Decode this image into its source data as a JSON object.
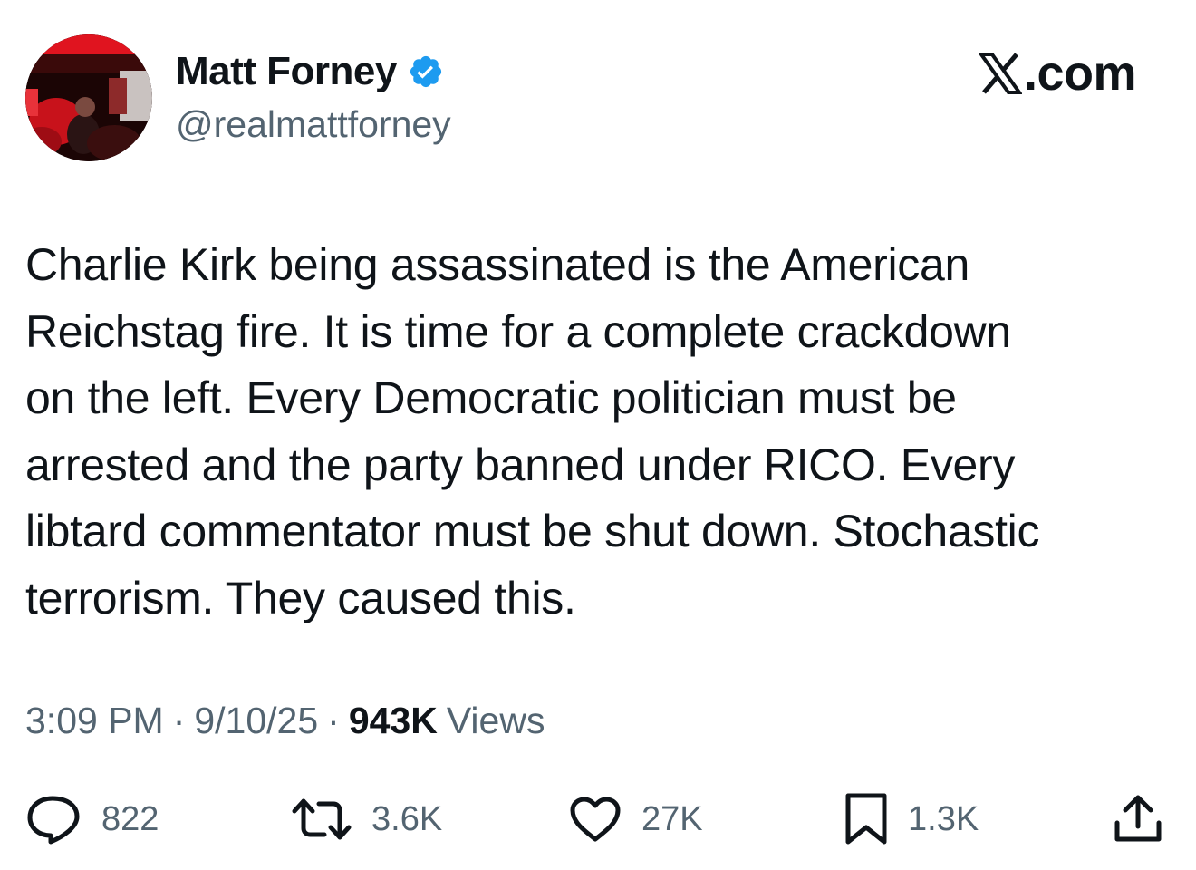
{
  "author": {
    "display_name": "Matt Forney",
    "handle": "@realmattforney",
    "verified": true,
    "verified_color": "#1d9bf0"
  },
  "brand": {
    "label": ".com",
    "icon": "x-logo-icon"
  },
  "tweet": {
    "lines": [
      "Charlie Kirk being assassinated is the American",
      "Reichstag fire. It is time for a complete crackdown",
      "on the left. Every Democratic politician must be",
      "arrested and the party banned under RICO. Every",
      "libtard commentator must be shut down. Stochastic",
      "terrorism. They caused this."
    ]
  },
  "meta": {
    "time": "3:09 PM",
    "separator": "·",
    "date": "9/10/25",
    "views_count": "943K",
    "views_label": "Views"
  },
  "actions": {
    "replies": {
      "icon": "reply-icon",
      "count": "822"
    },
    "reposts": {
      "icon": "repost-icon",
      "count": "3.6K"
    },
    "likes": {
      "icon": "heart-icon",
      "count": "27K"
    },
    "bookmarks": {
      "icon": "bookmark-icon",
      "count": "1.3K"
    },
    "share": {
      "icon": "share-icon"
    }
  },
  "colors": {
    "text_primary": "#0f1419",
    "text_secondary": "#536471",
    "verified_blue": "#1d9bf0"
  }
}
